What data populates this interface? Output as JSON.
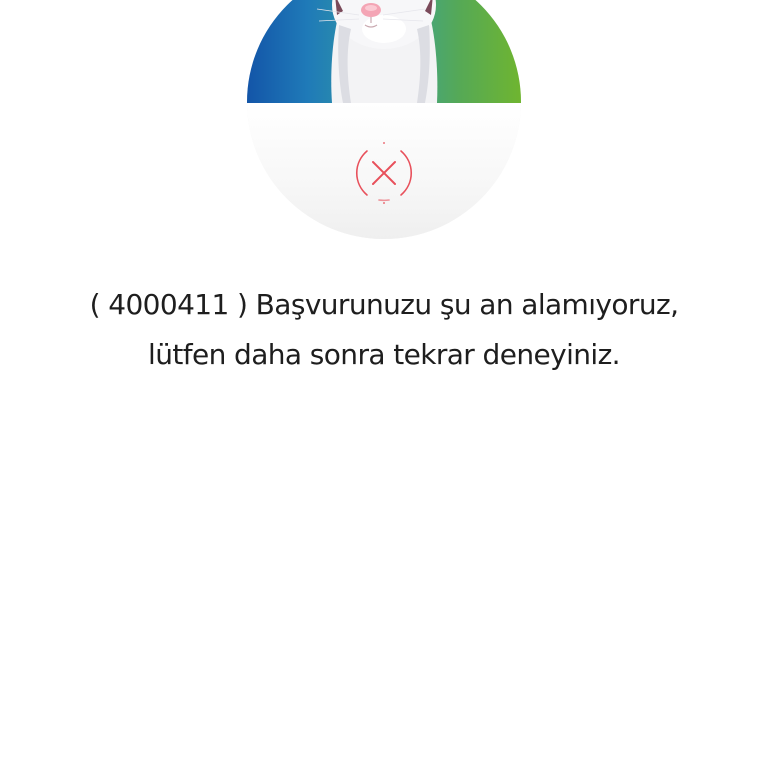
{
  "mascot": {
    "name": "white-rabbit-mascot",
    "band_colors": [
      "#1355a8",
      "#6fb530"
    ]
  },
  "status": {
    "icon": "error-x-icon",
    "color": "#e8505b"
  },
  "message": {
    "line1": "( 4000411 ) Başvurunuzu şu an alamıyoruz,",
    "line2": "lütfen daha sonra tekrar deneyiniz."
  }
}
